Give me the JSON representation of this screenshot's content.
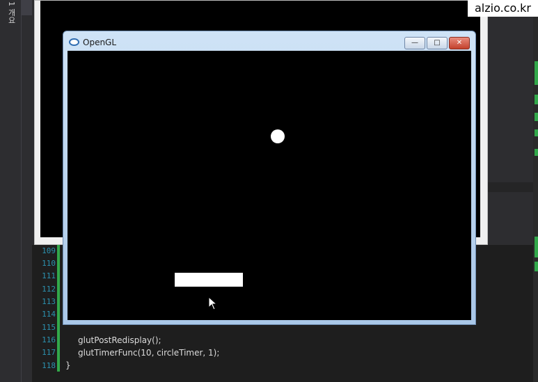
{
  "sidebar": {
    "vertical_label": "1 개요"
  },
  "watermark": {
    "text": "alzio.co.kr"
  },
  "background_window": {
    "bg": "#f0f0f0"
  },
  "opengl_window": {
    "title": "OpenGL",
    "buttons": {
      "minimize": "—",
      "maximize": "□",
      "close": "✕"
    },
    "icons": [
      "opengl-app-icon",
      "minimize-icon",
      "maximize-icon",
      "close-icon",
      "mouse-pointer-icon"
    ]
  },
  "editor": {
    "line_numbers": [
      "109",
      "110",
      "111",
      "112",
      "113",
      "114",
      "115",
      "116",
      "117",
      "118"
    ],
    "lines": {
      "l116": "glutPostRedisplay();",
      "l117": "glutTimerFunc(10, circleTimer, 1);",
      "l118": "}"
    }
  },
  "colors": {
    "line_number": "#2b91af",
    "change_marker": "#32a84a",
    "editor_bg": "#1e1e1e",
    "canvas_bg": "#000000",
    "shapes": "#ffffff"
  }
}
